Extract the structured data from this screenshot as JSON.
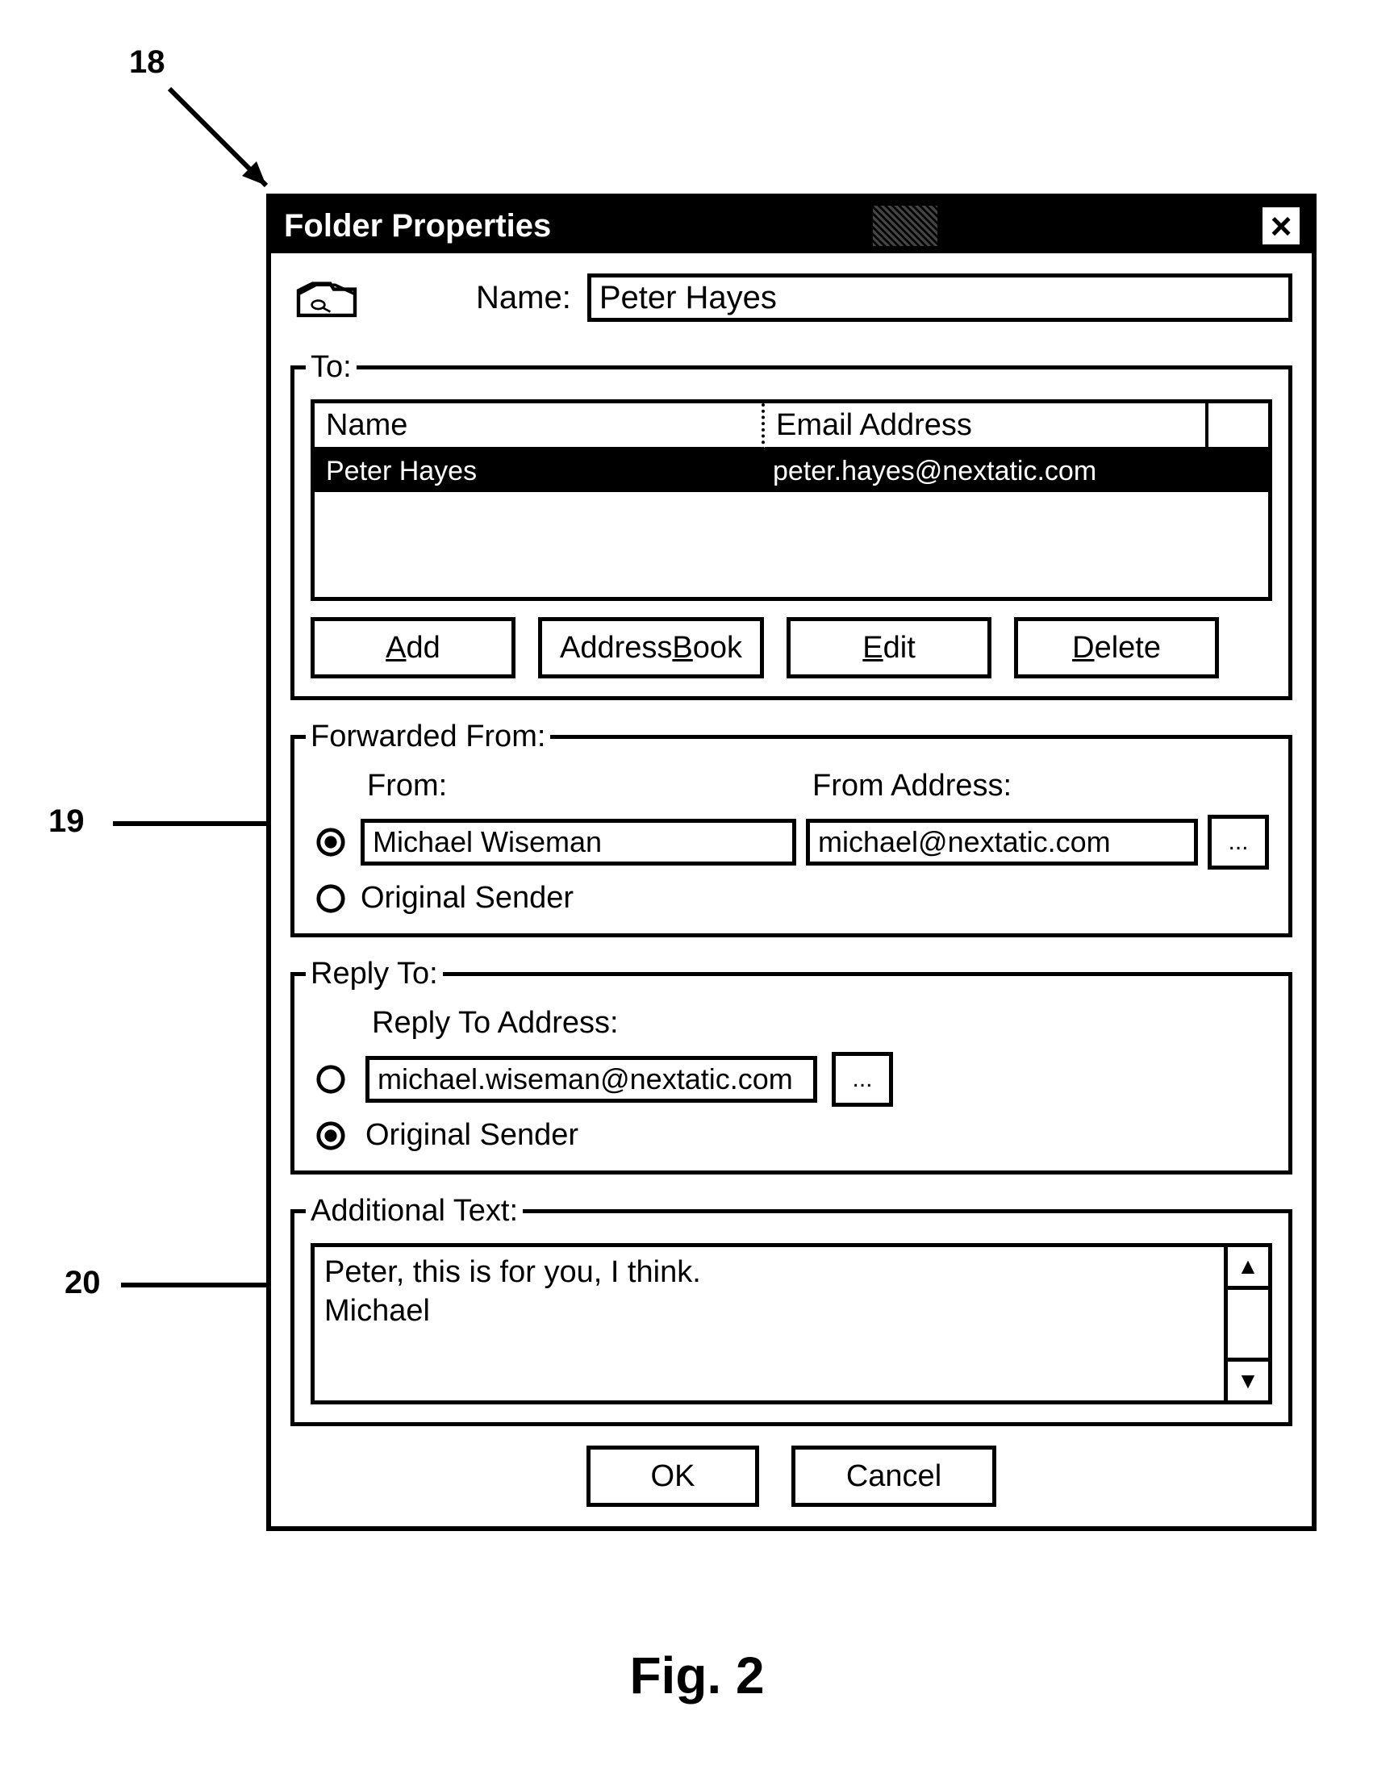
{
  "callouts": {
    "c18": "18",
    "c19": "19",
    "c20": "20"
  },
  "dialog": {
    "title": "Folder Properties",
    "close": "×",
    "name_label": "Name:",
    "name_value": "Peter Hayes"
  },
  "to": {
    "legend": "To:",
    "headers": {
      "name": "Name",
      "email": "Email Address"
    },
    "row": {
      "name": "Peter Hayes",
      "email": "peter.hayes@nextatic.com"
    },
    "buttons": {
      "add_pre": "",
      "add_u": "A",
      "add_post": "dd",
      "ab_pre": "Address ",
      "ab_u": "B",
      "ab_post": "ook",
      "edit_pre": "",
      "edit_u": "E",
      "edit_post": "dit",
      "del_pre": "",
      "del_u": "D",
      "del_post": "elete"
    }
  },
  "ff": {
    "legend": "Forwarded From:",
    "from_label": "From:",
    "addr_label": "From Address:",
    "from_value": "Michael Wiseman",
    "addr_value": "michael@nextatic.com",
    "orig_label": "Original Sender",
    "more": "..."
  },
  "rt": {
    "legend": "Reply To:",
    "addr_label": "Reply To Address:",
    "addr_value": "michael.wiseman@nextatic.com",
    "orig_label": "Original Sender",
    "more": "..."
  },
  "at": {
    "legend": "Additional Text:",
    "text": "Peter, this is for you, I think.\nMichael"
  },
  "footer": {
    "ok": "OK",
    "cancel": "Cancel"
  },
  "caption": "Fig. 2"
}
